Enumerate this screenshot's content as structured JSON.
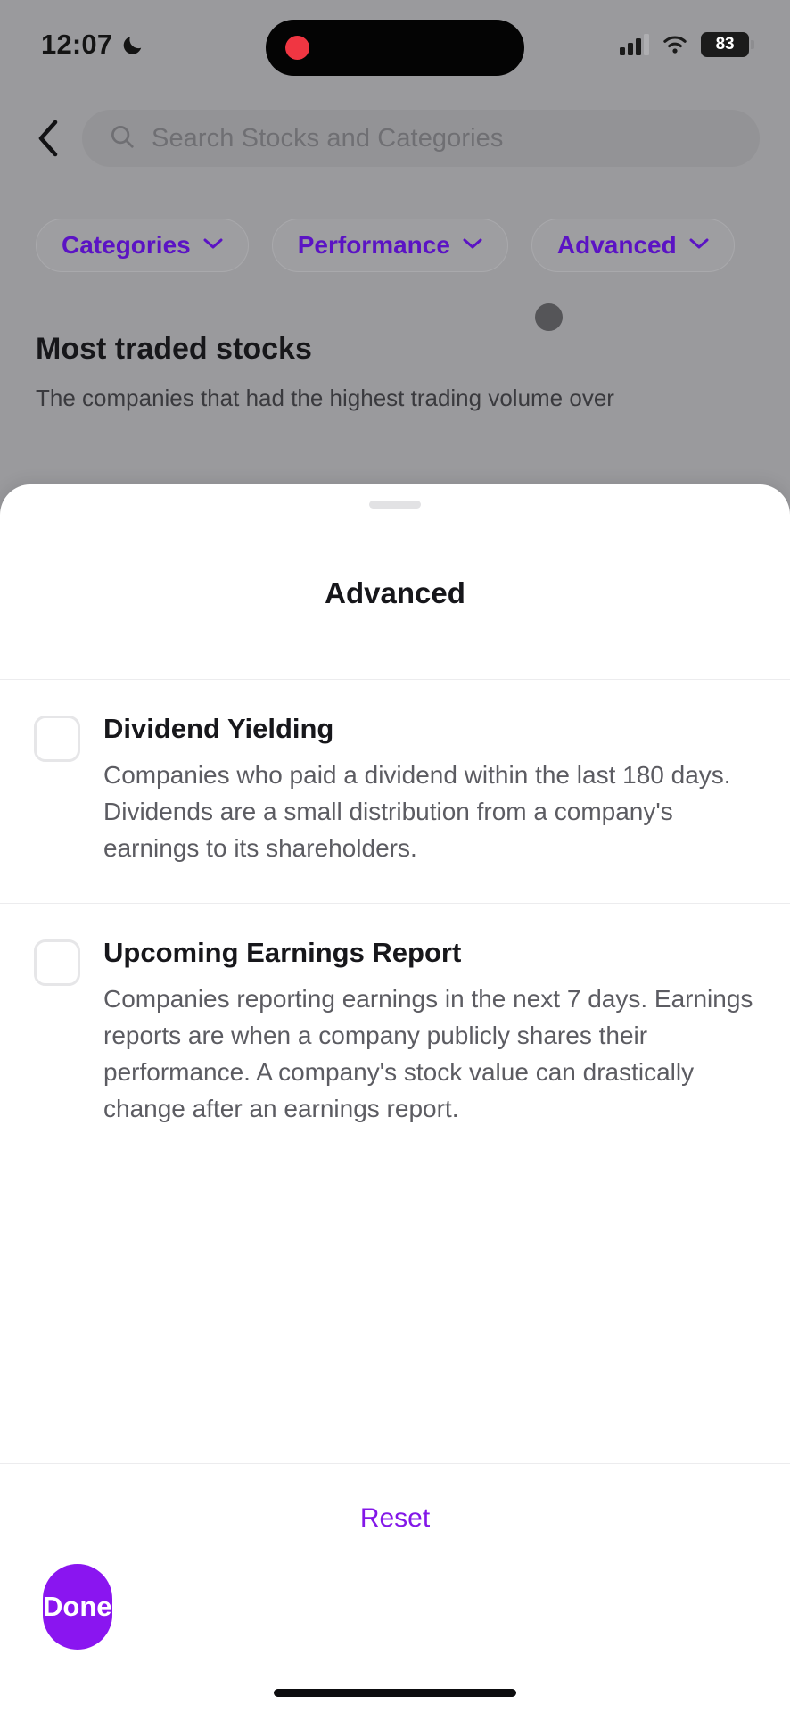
{
  "status_bar": {
    "time": "12:07",
    "dnd_icon": "moon-icon",
    "signal_icon": "cellular-signal-icon",
    "wifi_icon": "wifi-icon",
    "battery_level": "83",
    "recording_indicator": "record-dot-icon"
  },
  "background_app": {
    "back_icon": "back-chevron-icon",
    "search": {
      "icon": "search-icon",
      "placeholder": "Search Stocks and Categories",
      "value": ""
    },
    "filter_chips": [
      {
        "label": "Categories",
        "icon": "chevron-down-icon"
      },
      {
        "label": "Performance",
        "icon": "chevron-down-icon"
      },
      {
        "label": "Advanced",
        "icon": "chevron-down-icon"
      }
    ],
    "section": {
      "heading": "Most traded stocks",
      "subtitle": "The companies that had the highest trading volume over"
    }
  },
  "sheet": {
    "title": "Advanced",
    "drag_handle": "drag-handle",
    "options": [
      {
        "title": "Dividend Yielding",
        "description": "Companies who paid a dividend within the last 180 days. Dividends are a small distribution from a company's earnings to its shareholders.",
        "checked": false
      },
      {
        "title": "Upcoming Earnings Report",
        "description": "Companies reporting earnings in the next 7 days. Earnings reports are when a company publicly shares their performance. A company's stock value can drastically change after an earnings report.",
        "checked": false
      }
    ],
    "reset_label": "Reset",
    "done_label": "Done"
  },
  "colors": {
    "accent_purple": "#8a15f0",
    "chip_purple": "#5b13c4",
    "reset_purple": "#8317e8",
    "backdrop": "#9a9a9d",
    "record_red": "#f03642"
  }
}
